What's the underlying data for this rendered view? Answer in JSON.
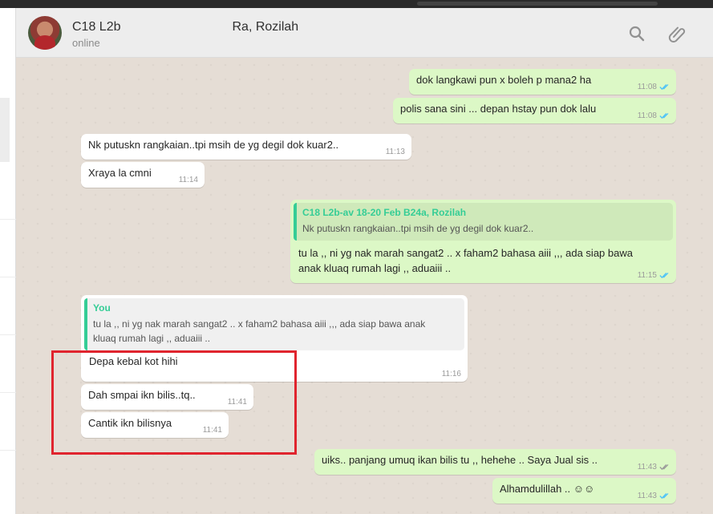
{
  "header": {
    "title_start": "C18 L2b",
    "title_end": "Ra, Rozilah",
    "status": "online"
  },
  "messages": [
    {
      "text": "dok langkawi pun x boleh p mana2  ha",
      "time": "11:08"
    },
    {
      "text": "polis sana sini ... depan hstay pun dok lalu",
      "time": "11:08"
    },
    {
      "text": "Nk putuskn rangkaian..tpi msih de yg degil dok kuar2..",
      "time": "11:13"
    },
    {
      "text": "Xraya la cmni",
      "time": "11:14"
    },
    {
      "quote_author": "C18 L2b-av 18-20 Feb B24a, Rozilah",
      "quote_text": "Nk putuskn rangkaian..tpi msih de yg degil dok kuar2..",
      "text_line1": "tu la ,, ni yg nak marah sangat2 .. x faham2 bahasa aiii ,,, ada siap bawa",
      "text_line2": "anak kluaq rumah lagi ,, aduaiii ..",
      "time": "11:15"
    },
    {
      "quote_author": "You",
      "quote_line1": "tu la ,, ni yg nak marah sangat2 .. x faham2 bahasa aiii ,,, ada siap bawa anak",
      "quote_line2": "kluaq rumah lagi ,, aduaiii ..",
      "text": "Depa kebal kot hihi",
      "time": "11:16"
    },
    {
      "text": "Dah smpai ikn bilis..tq..",
      "time": "11:41"
    },
    {
      "text": "Cantik ikn bilisnya",
      "time": "11:41"
    },
    {
      "text": "uiks.. panjang umuq ikan bilis tu ,, hehehe .. Saya Jual sis ..",
      "time": "11:43"
    },
    {
      "text": "Alhamdulillah .. ☺☺",
      "time": "11:43"
    }
  ],
  "colors": {
    "outgoing_bubble": "#dcf8c6",
    "incoming_bubble": "#ffffff",
    "read_tick": "#4fc3f7",
    "quote_bar": "#35cd96",
    "highlight_box": "#e0242e"
  },
  "icons": [
    "search-icon",
    "paperclip-icon",
    "double-check-icon"
  ]
}
